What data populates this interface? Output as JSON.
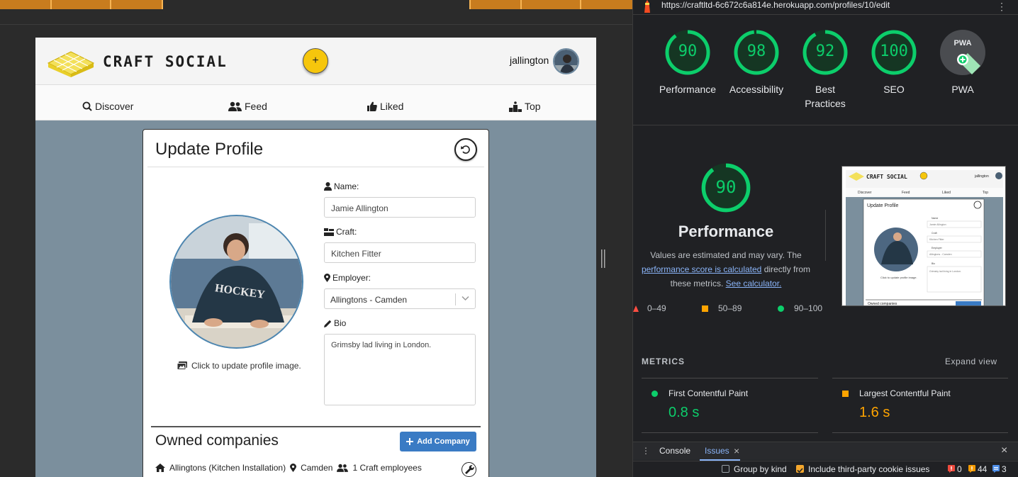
{
  "site": {
    "brand": "CRAFT SOCIAL",
    "add_icon": "plus-icon",
    "username": "jallington",
    "nav": [
      {
        "label": "Discover",
        "icon": "search-icon"
      },
      {
        "label": "Feed",
        "icon": "users-icon"
      },
      {
        "label": "Liked",
        "icon": "thumbs-up-icon"
      },
      {
        "label": "Top",
        "icon": "podium-icon"
      }
    ]
  },
  "profile_form": {
    "title": "Update Profile",
    "reset_icon": "undo-icon",
    "image_hint": "Click to update profile image.",
    "name_label": "Name:",
    "name_value": "Jamie Allington",
    "craft_label": "Craft:",
    "craft_value": "Kitchen Fitter",
    "employer_label": "Employer:",
    "employer_value": "Allingtons - Camden",
    "bio_label": "Bio",
    "bio_value": "Grimsby lad living in London."
  },
  "owned": {
    "title": "Owned companies",
    "add_label": "Add Company",
    "company_name": "Allingtons (Kitchen Installation)",
    "company_location": "Camden",
    "company_employees": "1 Craft employees"
  },
  "devtools": {
    "url": "https://craftltd-6c672c6a814e.herokuapp.com/profiles/10/edit",
    "scores": [
      {
        "label": "Performance",
        "value": "90",
        "fraction": 0.9
      },
      {
        "label": "Accessibility",
        "value": "98",
        "fraction": 0.98
      },
      {
        "label_line1": "Best",
        "label_line2": "Practices",
        "value": "92",
        "fraction": 0.92
      },
      {
        "label": "SEO",
        "value": "100",
        "fraction": 1.0
      },
      {
        "label": "PWA",
        "value": "PWA"
      }
    ],
    "perf_value": "90",
    "perf_title": "Performance",
    "perf_desc_1": "Values are estimated and may vary. The",
    "perf_link_1": "performance score is calculated",
    "perf_desc_2": "directly from",
    "perf_desc_3": "these metrics.",
    "perf_link_2": "See calculator.",
    "legend": [
      "0–49",
      "50–89",
      "90–100"
    ],
    "metrics_heading": "METRICS",
    "expand_label": "Expand view",
    "metrics": [
      {
        "name": "First Contentful Paint",
        "value": "0.8 s",
        "color": "#0cce6b"
      },
      {
        "name": "Largest Contentful Paint",
        "value": "1.6 s",
        "color": "#ffa400"
      }
    ],
    "drawer": {
      "console": "Console",
      "issues": "Issues",
      "group_by_kind": "Group by kind",
      "third_party": "Include third-party cookie issues",
      "count_errors": "0",
      "count_warnings": "44",
      "count_info": "3"
    },
    "thumbnail": {
      "brand": "CRAFT SOCIAL",
      "username": "jallington",
      "nav": [
        "Discover",
        "Feed",
        "Liked",
        "Top"
      ],
      "title": "Update Profile",
      "hint": "Click to update profile image.",
      "name_label": "Name",
      "name_value": "Jamie Allington",
      "craft_label": "Craft",
      "craft_value": "Kitchen Fitter",
      "employer_label": "Employer",
      "employer_value": "Allingtons - Camden",
      "bio_label": "Bio",
      "bio_value": "Grimsby lad living in London.",
      "owned": "Owned companies"
    }
  },
  "colors": {
    "green": "#0cce6b",
    "orange": "#ffa400",
    "red": "#ff4e42",
    "accent_blue": "#3a7bc4",
    "yellow": "#f6c60c"
  }
}
